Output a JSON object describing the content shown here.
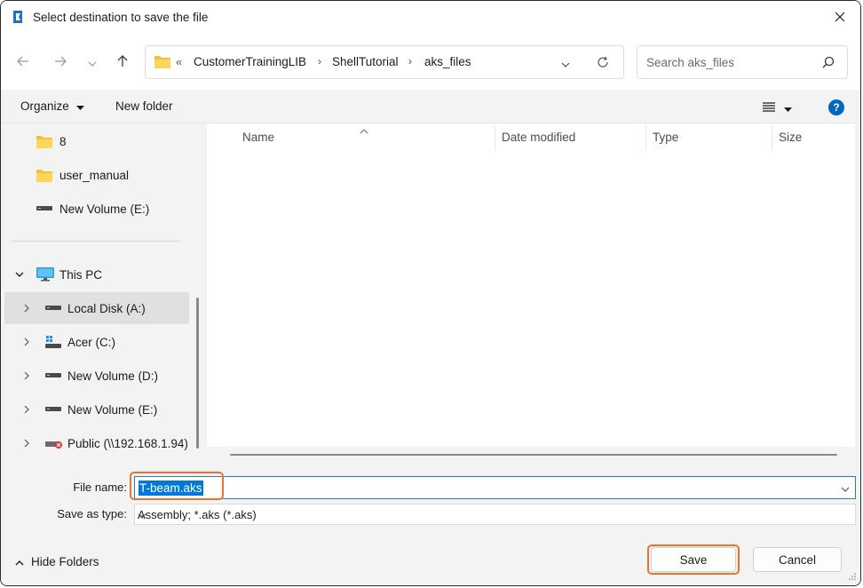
{
  "window": {
    "title": "Select destination to save the file",
    "app_icon": "app-logo-icon",
    "close_icon": "close-icon"
  },
  "nav": {
    "back_icon": "arrow-left-icon",
    "forward_icon": "arrow-right-icon",
    "recent_icon": "chevron-down-icon",
    "up_icon": "arrow-up-icon"
  },
  "address": {
    "more": "«",
    "crumbs": [
      "CustomerTrainingLIB",
      "ShellTutorial",
      "aks_files"
    ],
    "separator": "›"
  },
  "search": {
    "placeholder": "Search aks_files"
  },
  "toolbar": {
    "organize": "Organize",
    "new_folder": "New folder",
    "help": "?"
  },
  "sidebar": {
    "items": [
      {
        "label": "8",
        "icon": "folder-icon"
      },
      {
        "label": "user_manual",
        "icon": "folder-icon"
      },
      {
        "label": "New Volume (E:)",
        "icon": "drive-icon"
      },
      {
        "label": "This PC",
        "icon": "monitor-icon"
      },
      {
        "label": "Local Disk (A:)",
        "icon": "drive-icon"
      },
      {
        "label": "Acer (C:)",
        "icon": "windows-drive-icon"
      },
      {
        "label": "New Volume (D:)",
        "icon": "drive-icon"
      },
      {
        "label": "New Volume (E:)",
        "icon": "drive-icon"
      },
      {
        "label": "Public (\\\\192.168.1.94)",
        "icon": "network-drive-icon"
      }
    ]
  },
  "list": {
    "columns": [
      "Name",
      "Date modified",
      "Type",
      "Size"
    ]
  },
  "form": {
    "file_name_label": "File name:",
    "file_name_value": "T-beam.aks",
    "save_type_label": "Save as type:",
    "save_type_value": "Assembly; *.aks (*.aks)"
  },
  "footer": {
    "hide_folders": "Hide Folders",
    "save": "Save",
    "cancel": "Cancel"
  },
  "colors": {
    "accent": "#0067c0",
    "selection": "#0078d7",
    "highlight_box": "#e8752e"
  }
}
